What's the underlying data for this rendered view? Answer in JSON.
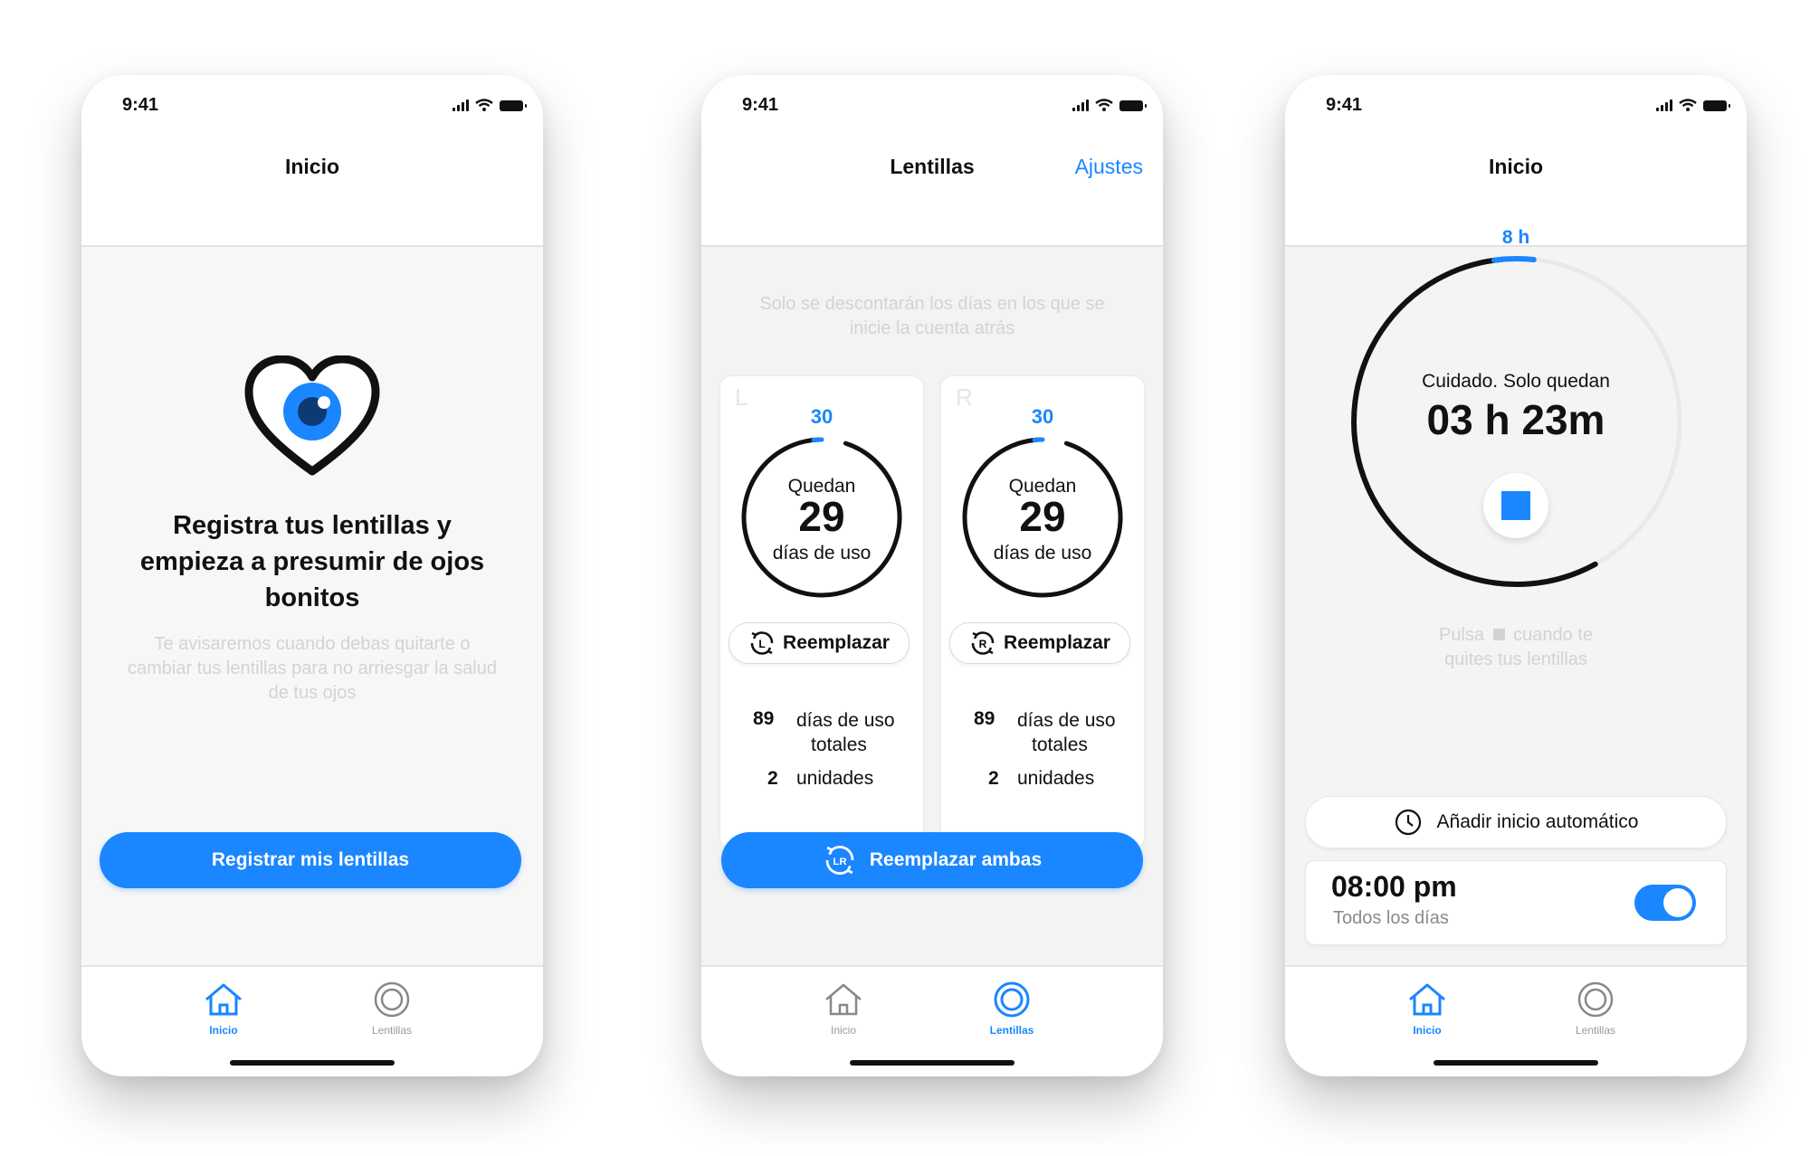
{
  "status": {
    "time": "9:41"
  },
  "screen1": {
    "title": "Inicio",
    "headline": [
      "Registra tus lentillas y",
      "empieza  a presumir de ojos",
      "bonitos"
    ],
    "subtitle": [
      "Te avisaremos cuando debas quitarte o",
      "cambiar tus lentillas para no arriesgar la salud",
      "de tus ojos"
    ],
    "button": "Registrar mis lentillas",
    "logo": "heart-eye-icon"
  },
  "screen2": {
    "title": "Lentillas",
    "settings": "Ajustes",
    "note": [
      "Solo se descontarán los días en los que se",
      "inicie la cuenta atrás"
    ],
    "cards": [
      {
        "side": "L",
        "total": "30",
        "label_top": "Quedan",
        "value": "29",
        "label_bottom": "días de uso",
        "progress": 0.967,
        "replace": "Reemplazar",
        "icon_letter": "L",
        "usage_count": "89",
        "usage_label": [
          "días de uso",
          "totales"
        ],
        "units_count": "2",
        "units_label": "unidades"
      },
      {
        "side": "R",
        "total": "30",
        "label_top": "Quedan",
        "value": "29",
        "label_bottom": "días de uso",
        "progress": 0.967,
        "replace": "Reemplazar",
        "icon_letter": "R",
        "usage_count": "89",
        "usage_label": [
          "días de uso",
          "totales"
        ],
        "units_count": "2",
        "units_label": "unidades"
      }
    ],
    "button": "Reemplazar ambas",
    "button_icon": "LR"
  },
  "screen3": {
    "title": "Inicio",
    "timer_max": "8 h",
    "warning": "Cuidado. Solo quedan",
    "remaining": "03 h 23m",
    "progress": 0.58,
    "hint": [
      "Pulsa",
      "cuando te",
      "quites tus lentillas"
    ],
    "auto_start": "Añadir inicio automático",
    "alarm_time": "08:00 pm",
    "alarm_repeat": "Todos los días",
    "alarm_enabled": true
  },
  "tabs": {
    "home": "Inicio",
    "lenses": "Lentillas"
  },
  "colors": {
    "accent": "#1a86ff",
    "text": "#111111",
    "muted": "#d3d3d3",
    "background": "#f7f7f7"
  }
}
